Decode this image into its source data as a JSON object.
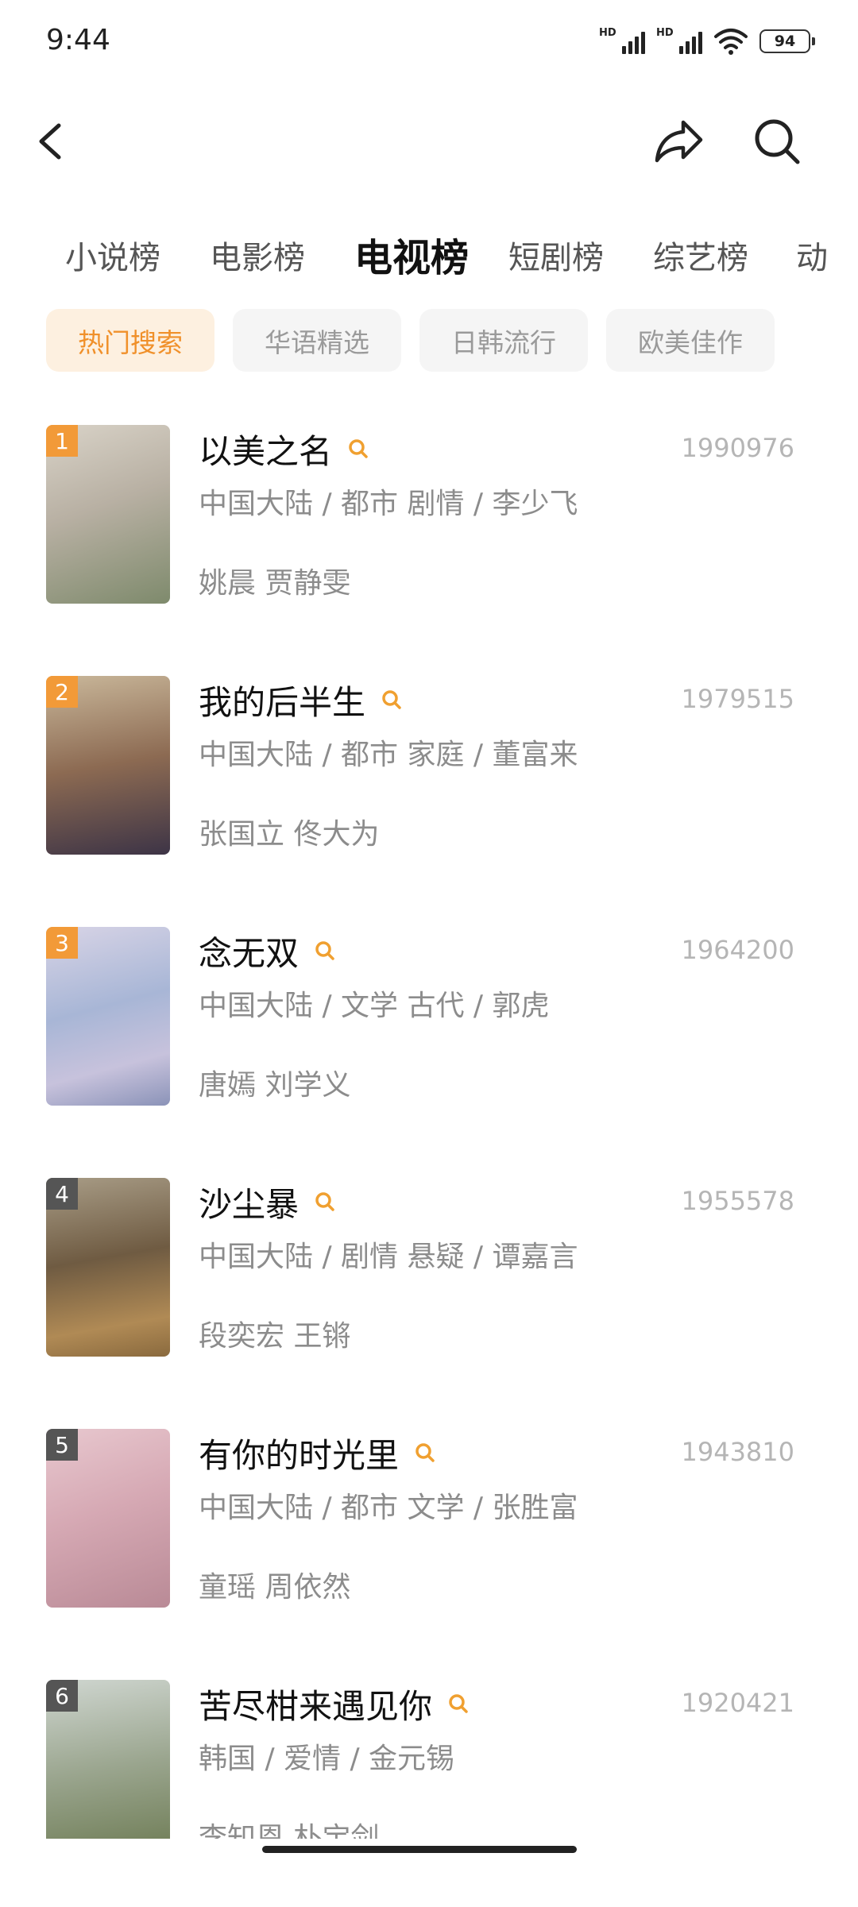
{
  "status_bar": {
    "time": "9:44",
    "battery": "94",
    "signal_label": "HD"
  },
  "tabs": [
    {
      "label": "小说榜",
      "active": false
    },
    {
      "label": "电影榜",
      "active": false
    },
    {
      "label": "电视榜",
      "active": true
    },
    {
      "label": "短剧榜",
      "active": false
    },
    {
      "label": "综艺榜",
      "active": false
    },
    {
      "label": "动",
      "active": false
    }
  ],
  "filters": [
    {
      "label": "热门搜索",
      "active": true
    },
    {
      "label": "华语精选",
      "active": false
    },
    {
      "label": "日韩流行",
      "active": false
    },
    {
      "label": "欧美佳作",
      "active": false
    }
  ],
  "list": [
    {
      "rank": "1",
      "title": "以美之名",
      "count": "1990976",
      "meta": "中国大陆 / 都市 剧情 / 李少飞",
      "cast": "姚晨 贾静雯",
      "rank_color": "#f29a38"
    },
    {
      "rank": "2",
      "title": "我的后半生",
      "count": "1979515",
      "meta": "中国大陆 / 都市 家庭 / 董富来",
      "cast": "张国立 佟大为",
      "rank_color": "#f29a38"
    },
    {
      "rank": "3",
      "title": "念无双",
      "count": "1964200",
      "meta": "中国大陆 / 文学 古代 / 郭虎",
      "cast": "唐嫣 刘学义",
      "rank_color": "#f29a38"
    },
    {
      "rank": "4",
      "title": "沙尘暴",
      "count": "1955578",
      "meta": "中国大陆 / 剧情 悬疑 / 谭嘉言",
      "cast": "段奕宏 王锵",
      "rank_color": "#555555"
    },
    {
      "rank": "5",
      "title": "有你的时光里",
      "count": "1943810",
      "meta": "中国大陆 / 都市 文学 / 张胜富",
      "cast": "童瑶 周依然",
      "rank_color": "#555555"
    },
    {
      "rank": "6",
      "title": "苦尽柑来遇见你",
      "count": "1920421",
      "meta": "韩国 / 爱情 / 金元锡",
      "cast": "李知恩 朴宝剑",
      "rank_color": "#555555"
    }
  ],
  "colors": {
    "accent": "#f0902a",
    "chip_active_bg": "#fdf0e0",
    "text_secondary": "#8c8c8c"
  },
  "icons": [
    "back-arrow-icon",
    "share-icon",
    "search-icon",
    "wifi-icon",
    "battery-icon"
  ]
}
